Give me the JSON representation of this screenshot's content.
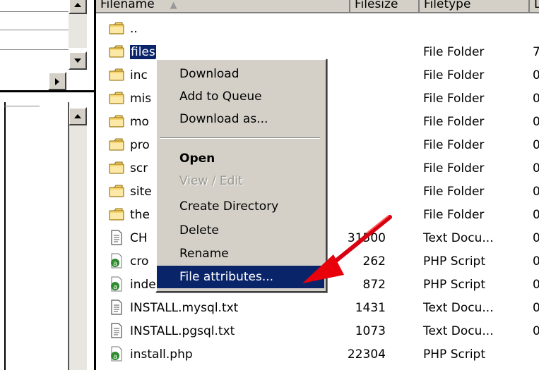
{
  "columns": {
    "filename": "Filename",
    "filesize": "Filesize",
    "filetype": "Filetype",
    "extra": "L"
  },
  "rows": [
    {
      "name": "..",
      "size": "",
      "type": "",
      "extra": "",
      "icon": "folder-icon"
    },
    {
      "name": "files",
      "size": "",
      "type": "File Folder",
      "extra": "7",
      "icon": "folder-icon"
    },
    {
      "name": "inc",
      "size": "",
      "type": "File Folder",
      "extra": "0",
      "icon": "folder-icon"
    },
    {
      "name": "mis",
      "size": "",
      "type": "File Folder",
      "extra": "0",
      "icon": "folder-icon"
    },
    {
      "name": "mo",
      "size": "",
      "type": "File Folder",
      "extra": "0",
      "icon": "folder-icon"
    },
    {
      "name": "pro",
      "size": "",
      "type": "File Folder",
      "extra": "0",
      "icon": "folder-icon"
    },
    {
      "name": "scr",
      "size": "",
      "type": "File Folder",
      "extra": "0",
      "icon": "folder-icon"
    },
    {
      "name": "site",
      "size": "",
      "type": "File Folder",
      "extra": "0",
      "icon": "folder-icon"
    },
    {
      "name": "the",
      "size": "",
      "type": "File Folder",
      "extra": "0",
      "icon": "folder-icon"
    },
    {
      "name": "CH",
      "size": "31500",
      "type": "Text Docu...",
      "extra": "0",
      "icon": "text-document-icon"
    },
    {
      "name": "cro",
      "size": "262",
      "type": "PHP Script",
      "extra": "0",
      "icon": "php-script-icon"
    },
    {
      "name": "index.php",
      "size": "872",
      "type": "PHP Script",
      "extra": "0",
      "icon": "php-script-icon"
    },
    {
      "name": "INSTALL.mysql.txt",
      "size": "1431",
      "type": "Text Docu...",
      "extra": "0",
      "icon": "text-document-icon"
    },
    {
      "name": "INSTALL.pgsql.txt",
      "size": "1073",
      "type": "Text Docu...",
      "extra": "0",
      "icon": "text-document-icon"
    },
    {
      "name": "install.php",
      "size": "22304",
      "type": "PHP Script",
      "extra": "",
      "icon": "php-script-icon"
    }
  ],
  "context_menu": {
    "download": "Download",
    "add_to_queue": "Add to Queue",
    "download_as": "Download as...",
    "open": "Open",
    "view_edit": "View / Edit",
    "create_directory": "Create Directory",
    "delete": "Delete",
    "rename": "Rename",
    "file_attributes": "File attributes..."
  },
  "colors": {
    "selection": "#0a246a",
    "menu_bg": "#d4d0c8",
    "folder": "#f5d36b",
    "arrow": "#e8000b"
  }
}
